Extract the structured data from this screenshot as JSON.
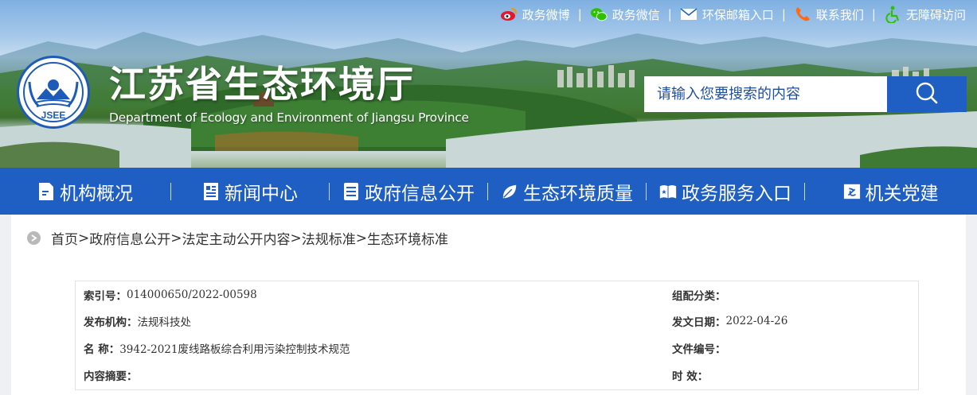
{
  "header": {
    "title": "江苏省生态环境厅",
    "subtitle": "Department of Ecology and Environment of Jiangsu Province",
    "logo_text": "JSEE",
    "top_links": [
      {
        "label": "政务微博",
        "icon": "weibo-icon"
      },
      {
        "label": "政务微信",
        "icon": "wechat-icon"
      },
      {
        "label": "环保邮箱入口",
        "icon": "mail-icon"
      },
      {
        "label": "联系我们",
        "icon": "phone-icon"
      },
      {
        "label": "无障碍访问",
        "icon": "accessibility-icon"
      }
    ],
    "separator": "|"
  },
  "search": {
    "placeholder": "请输入您要搜索的内容",
    "icon": "search-icon"
  },
  "nav": {
    "items": [
      {
        "label": "机构概况",
        "icon": "org-doc-icon"
      },
      {
        "label": "新闻中心",
        "icon": "news-icon"
      },
      {
        "label": "政府信息公开",
        "icon": "info-list-icon"
      },
      {
        "label": "生态环境质量",
        "icon": "leaf-icon"
      },
      {
        "label": "政务服务入口",
        "icon": "service-book-icon"
      },
      {
        "label": "机关党建",
        "icon": "party-flag-icon"
      }
    ]
  },
  "breadcrumb": {
    "items": [
      "首页",
      "政府信息公开",
      "法定主动公开内容",
      "法规标准",
      "生态环境标准"
    ],
    "separator": ">"
  },
  "meta": {
    "index_label": "索引号：",
    "index_value": "014000650/2022-00598",
    "category_label": "组配分类：",
    "category_value": "",
    "publisher_label": "发布机构：",
    "publisher_value": "法规科技处",
    "date_label": "发文日期：",
    "date_value": "2022-04-26",
    "name_label": "名 称：",
    "name_value": "3942-2021废线路板综合利用污染控制技术规范",
    "docno_label": "文件编号：",
    "docno_value": "",
    "abstract_label": "内容摘要：",
    "abstract_value": "",
    "validity_label": "时 效：",
    "validity_value": ""
  },
  "colors": {
    "primary_blue": "#1f5fc4",
    "breadcrumb_dot": "#b9b9b9",
    "side_gray": "#eef0f4"
  }
}
